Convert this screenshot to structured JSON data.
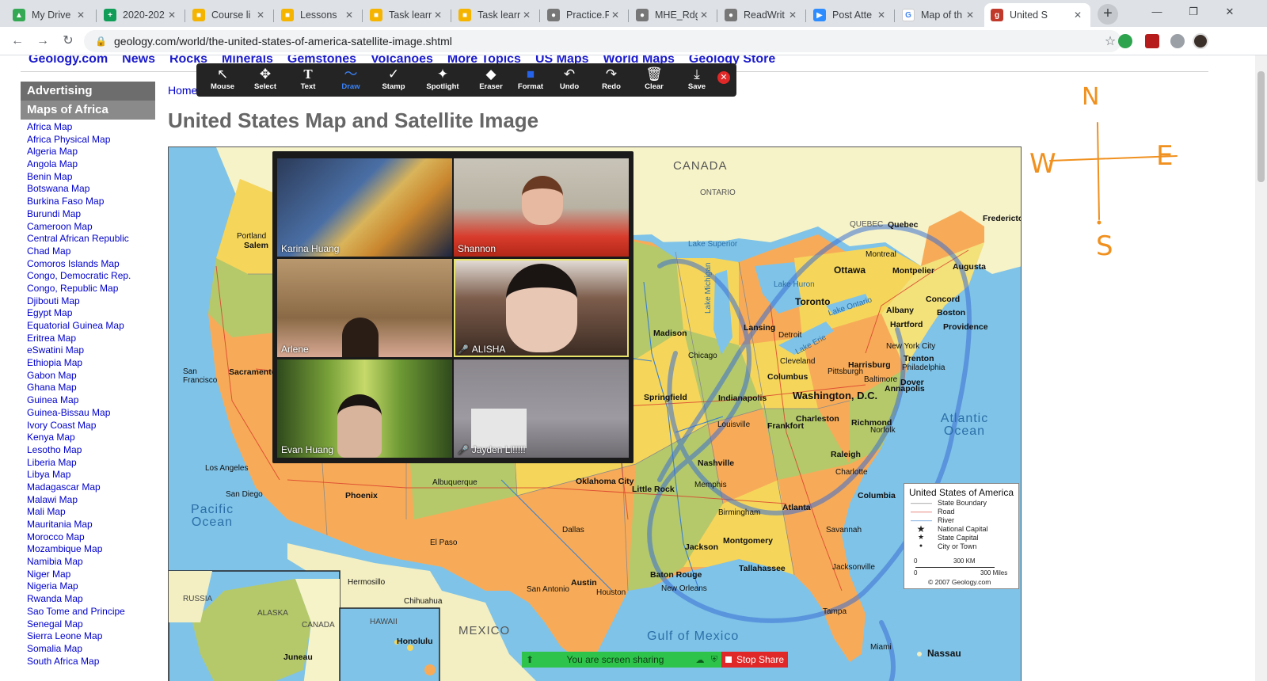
{
  "browser": {
    "tabs": [
      {
        "label": "My Drive",
        "fav_color": "#34a853",
        "fav": "▲"
      },
      {
        "label": "2020-202",
        "fav_color": "#0f9d58",
        "fav": "+"
      },
      {
        "label": "Course li",
        "fav_color": "#f4b400",
        "fav": "■"
      },
      {
        "label": "Lessons",
        "fav_color": "#f4b400",
        "fav": "■"
      },
      {
        "label": "Task learr",
        "fav_color": "#f4b400",
        "fav": "■"
      },
      {
        "label": "Task learr",
        "fav_color": "#f4b400",
        "fav": "■"
      },
      {
        "label": "Practice.F",
        "fav_color": "#777777",
        "fav": "●"
      },
      {
        "label": "MHE_Rdg",
        "fav_color": "#777777",
        "fav": "●"
      },
      {
        "label": "ReadWrit",
        "fav_color": "#777777",
        "fav": "●"
      },
      {
        "label": "Post Atte",
        "fav_color": "#2d8cff",
        "fav": "▶"
      },
      {
        "label": "Map of th",
        "fav_color": "#4285f4",
        "fav": "G"
      },
      {
        "label": "United S",
        "fav_color": "#c0392b",
        "fav": "g"
      }
    ],
    "url": "geology.com/world/the-united-states-of-america-satellite-image.shtml"
  },
  "site": {
    "nav": [
      "Geology.com",
      "News",
      "Rocks",
      "Minerals",
      "Gemstones",
      "Volcanoes",
      "More Topics",
      "US Maps",
      "World Maps",
      "Geology Store"
    ],
    "breadcrumb": "Home",
    "title": "United States Map and Satellite Image"
  },
  "sidebar": {
    "advertising": "Advertising",
    "maps_heading": "Maps of Africa",
    "items": [
      "Africa Map",
      "Africa Physical Map",
      "Algeria Map",
      "Angola Map",
      "Benin Map",
      "Botswana Map",
      "Burkina Faso Map",
      "Burundi Map",
      "Cameroon Map",
      "Central African Republic",
      "Chad Map",
      "Comoros Islands Map",
      "Congo, Democratic Rep.",
      "Congo, Republic Map",
      "Djibouti Map",
      "Egypt Map",
      "Equatorial Guinea Map",
      "Eritrea Map",
      "eSwatini Map",
      "Ethiopia Map",
      "Gabon Map",
      "Ghana Map",
      "Guinea Map",
      "Guinea-Bissau Map",
      "Ivory Coast Map",
      "Kenya Map",
      "Lesotho Map",
      "Liberia Map",
      "Libya Map",
      "Madagascar Map",
      "Malawi Map",
      "Mali Map",
      "Mauritania Map",
      "Morocco Map",
      "Mozambique Map",
      "Namibia Map",
      "Niger Map",
      "Nigeria Map",
      "Rwanda Map",
      "Sao Tome and Principe",
      "Senegal Map",
      "Sierra Leone Map",
      "Somalia Map",
      "South Africa Map"
    ]
  },
  "map": {
    "labels": {
      "canada": "CANADA",
      "ontario": "ONTARIO",
      "quebec": "QUEBEC",
      "mexico": "MEXICO",
      "russia": "RUSSIA",
      "alaska": "ALASKA",
      "canada_small": "CANADA",
      "hawaii": "HAWAII",
      "pacific": "Pacific Ocean",
      "atlantic": "Atlantic Ocean",
      "gulf": "Gulf of Mexico",
      "washington_dc": "Washington, D.C.",
      "ottawa": "Ottawa",
      "montreal": "Montreal",
      "montpelier": "Montpelier",
      "augusta": "Augusta",
      "concord": "Concord",
      "boston": "Boston",
      "providence": "Providence",
      "hartford": "Hartford",
      "albany": "Albany",
      "toronto": "Toronto",
      "chicago": "Chicago",
      "columbus": "Columbus",
      "lansing": "Lansing",
      "madison": "Madison",
      "indianapolis": "Indianapolis",
      "springfield": "Springfield",
      "nashville": "Nashville",
      "atlanta": "Atlanta",
      "montgomery": "Montgomery",
      "jackson": "Jackson",
      "tallahassee": "Tallahassee",
      "austin": "Austin",
      "phoenix": "Phoenix",
      "sacramento": "Sacramento",
      "salem": "Salem",
      "oklahoma_city": "Oklahoma City",
      "little_rock": "Little Rock",
      "baton_rouge": "Baton Rouge",
      "columbia": "Columbia",
      "raleigh": "Raleigh",
      "richmond": "Richmond",
      "charleston": "Charleston",
      "frankfort": "Frankfort",
      "harrisburg": "Harrisburg",
      "trenton": "Trenton",
      "dover": "Dover",
      "annapolis": "Annapolis",
      "quebec_city": "Quebec",
      "fredericton": "Fredericton",
      "honolulu": "Honolulu",
      "juneau": "Juneau",
      "nassau": "Nassau",
      "hermosillo": "Hermosillo",
      "chihuahua": "Chihuahua",
      "houston": "Houston",
      "dallas": "Dallas",
      "san_antonio": "San Antonio",
      "new_orleans": "New Orleans",
      "miami": "Miami",
      "los_angeles": "Los Angeles",
      "san_diego": "San Diego",
      "san_francisco": "San Francisco",
      "portland": "Portland",
      "albuquerque": "Albuquerque",
      "el_paso": "El Paso",
      "memphis": "Memphis",
      "birmingham": "Birmingham",
      "jacksonville": "Jacksonville",
      "tampa": "Tampa",
      "savannah": "Savannah",
      "charlotte": "Charlotte",
      "louisville": "Louisville",
      "detroit": "Detroit",
      "cleveland": "Cleveland",
      "pittsburgh": "Pittsburgh",
      "new_york_city": "New York City",
      "philadelphia": "Philadelphia",
      "baltimore": "Baltimore",
      "norfolk": "Norfolk",
      "lake_superior": "Lake Superior",
      "lake_michigan": "Lake Michigan",
      "lake_huron": "Lake Huron",
      "lake_erie": "Lake Erie",
      "lake_ontario": "Lake Ontario"
    },
    "legend": {
      "title": "United States of America",
      "rows": [
        {
          "symbol": "—",
          "label": "State Boundary",
          "color": "#777777"
        },
        {
          "symbol": "—",
          "label": "Road",
          "color": "#d93b2b"
        },
        {
          "symbol": "—",
          "label": "River",
          "color": "#3a7fd1"
        },
        {
          "symbol": "★",
          "label": "National Capital",
          "color": "#111111"
        },
        {
          "symbol": "★",
          "label": "State Capital",
          "color": "#111111"
        },
        {
          "symbol": "●",
          "label": "City or Town",
          "color": "#111111"
        }
      ],
      "scale_km": "300 KM",
      "scale_miles": "300 Miles",
      "scale_zero": "0",
      "copyright": "© 2007 Geology.com"
    }
  },
  "zoom_toolbar": {
    "tools": [
      {
        "label": "Mouse",
        "icon": "↖"
      },
      {
        "label": "Select",
        "icon": "✥"
      },
      {
        "label": "Text",
        "icon": "T"
      },
      {
        "label": "Draw",
        "icon": "〜"
      },
      {
        "label": "Stamp",
        "icon": "✓"
      },
      {
        "label": "Spotlight",
        "icon": "✦"
      },
      {
        "label": "Eraser",
        "icon": "◆"
      },
      {
        "label": "Format",
        "icon": "■"
      },
      {
        "label": "Undo",
        "icon": "↶"
      },
      {
        "label": "Redo",
        "icon": "↷"
      },
      {
        "label": "Clear",
        "icon": "🗑"
      },
      {
        "label": "Save",
        "icon": "⤓"
      }
    ],
    "close_icon": "✕"
  },
  "gallery": {
    "participants": [
      {
        "name": "Karina Huang",
        "muted": false
      },
      {
        "name": "Shannon",
        "muted": false
      },
      {
        "name": "Arlene",
        "muted": false
      },
      {
        "name": "ALISHA",
        "muted": true
      },
      {
        "name": "Evan Huang",
        "muted": false
      },
      {
        "name": "Jayden Li!!!!!",
        "muted": true
      }
    ]
  },
  "share_bar": {
    "status": "You are screen sharing",
    "stop_label": "Stop Share"
  },
  "annotation": {
    "north": "N",
    "south": "S",
    "east": "E",
    "west": "W",
    "color": "#f0901e"
  }
}
